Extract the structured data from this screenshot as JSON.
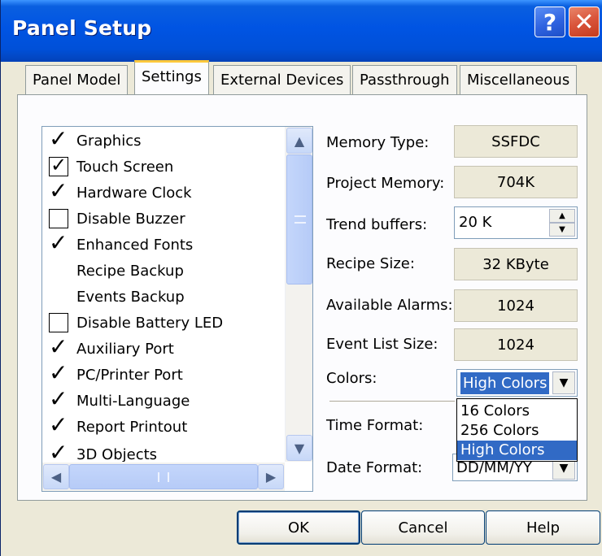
{
  "window": {
    "title": "Panel Setup"
  },
  "titlebar_buttons": {
    "help": "?",
    "close": "✕"
  },
  "tabs": [
    {
      "label": "Panel Model",
      "active": false
    },
    {
      "label": "Settings",
      "active": true
    },
    {
      "label": "External Devices",
      "active": false
    },
    {
      "label": "Passthrough",
      "active": false
    },
    {
      "label": "Miscellaneous",
      "active": false
    }
  ],
  "features": [
    {
      "label": "Graphics",
      "mark": "check"
    },
    {
      "label": "Touch Screen",
      "mark": "checkbox-checked"
    },
    {
      "label": "Hardware Clock",
      "mark": "check"
    },
    {
      "label": "Disable Buzzer",
      "mark": "checkbox-empty"
    },
    {
      "label": "Enhanced Fonts",
      "mark": "check"
    },
    {
      "label": "Recipe Backup",
      "mark": "none"
    },
    {
      "label": "Events Backup",
      "mark": "none"
    },
    {
      "label": "Disable Battery LED",
      "mark": "checkbox-empty"
    },
    {
      "label": "Auxiliary Port",
      "mark": "check"
    },
    {
      "label": "PC/Printer Port",
      "mark": "check"
    },
    {
      "label": "Multi-Language",
      "mark": "check"
    },
    {
      "label": "Report Printout",
      "mark": "check"
    },
    {
      "label": "3D Objects",
      "mark": "check"
    }
  ],
  "scroll_glyphs": {
    "up": "▲",
    "down": "▼",
    "left": "◀",
    "right": "▶"
  },
  "properties": {
    "memory_type": {
      "label": "Memory Type:",
      "value": "SSFDC"
    },
    "project_memory": {
      "label": "Project Memory:",
      "value": "704K"
    },
    "trend_buffers": {
      "label": "Trend buffers:",
      "value": "20 K"
    },
    "recipe_size": {
      "label": "Recipe Size:",
      "value": "32 KByte"
    },
    "available_alarms": {
      "label": "Available Alarms:",
      "value": "1024"
    },
    "event_list_size": {
      "label": "Event List Size:",
      "value": "1024"
    },
    "colors": {
      "label": "Colors:",
      "value": "High Colors",
      "options": [
        "16 Colors",
        "256 Colors",
        "High Colors"
      ]
    },
    "time_format": {
      "label": "Time Format:"
    },
    "date_format": {
      "label": "Date Format:",
      "value": "DD/MM/YY"
    }
  },
  "buttons": {
    "ok": "OK",
    "cancel": "Cancel",
    "help": "Help"
  }
}
